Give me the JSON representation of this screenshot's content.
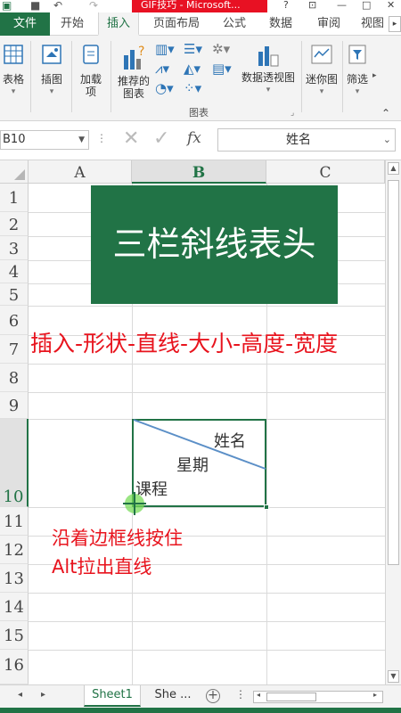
{
  "title": {
    "badge": "GIF技巧 - Microsoft..."
  },
  "window": {
    "help": "?",
    "minimize": "—",
    "maximize": "□",
    "close": "✕"
  },
  "tabs": {
    "file": "文件",
    "home": "开始",
    "insert": "插入",
    "layout": "页面布局",
    "formulas": "公式",
    "data": "数据",
    "review": "审阅",
    "view": "视图",
    "scroll": "▸"
  },
  "ribbon": {
    "table": "表格",
    "illustrations": "插图",
    "addins_1": "加载",
    "addins_2": "项",
    "recommended_1": "推荐的",
    "recommended_2": "图表",
    "pivot_chart": "数据透视图",
    "sparkline": "迷你图",
    "filter": "筛选",
    "group_charts": "图表"
  },
  "formula_bar": {
    "name_box": "B10",
    "cancel": "✕",
    "enter": "✓",
    "fx": "fx",
    "content": "姓名"
  },
  "columns": [
    "A",
    "B",
    "C"
  ],
  "rows": [
    "1",
    "2",
    "3",
    "4",
    "5",
    "6",
    "7",
    "8",
    "9",
    "10",
    "11",
    "12",
    "13",
    "14",
    "15",
    "16"
  ],
  "sheet": {
    "banner": "三栏斜线表头",
    "instruction": "插入-形状-直线-大小-高度-宽度",
    "cell_b10": {
      "top_right": "姓名",
      "middle": "星期",
      "bottom_left": "课程"
    },
    "hint_line1": "沿着边框线按住",
    "hint_line2": "Alt拉出直线"
  },
  "sheet_tabs": {
    "active": "Sheet1",
    "second": "She ...",
    "add": "+"
  },
  "colors": {
    "excel_green": "#217346",
    "note_red": "#e8141e",
    "diagonal_blue": "#5b8fc7"
  }
}
